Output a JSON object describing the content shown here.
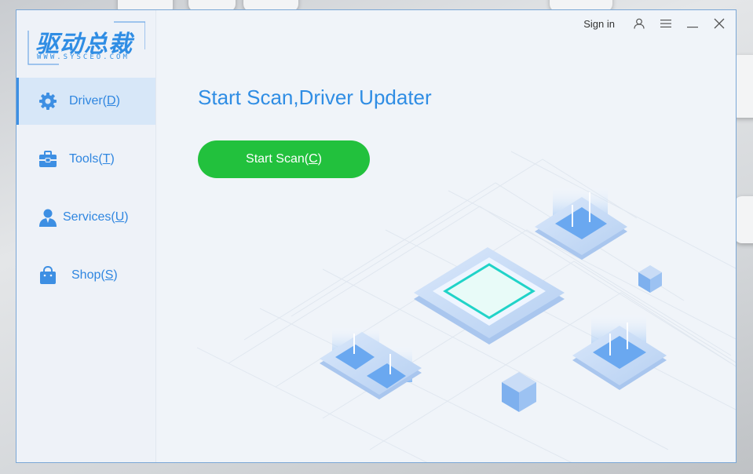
{
  "app": {
    "logo_text": "驱动总裁",
    "logo_sub": "WWW.SYSCEO.COM"
  },
  "topbar": {
    "signin_label": "Sign in",
    "user_icon": "user-icon",
    "menu_icon": "hamburger-menu-icon",
    "minimize_icon": "minimize-icon",
    "close_icon": "close-icon"
  },
  "sidebar": {
    "items": [
      {
        "label": "Driver",
        "hotkey": "D",
        "icon": "gear-icon",
        "active": true
      },
      {
        "label": "Tools",
        "hotkey": "T",
        "icon": "toolbox-icon",
        "active": false
      },
      {
        "label": "Services",
        "hotkey": "U",
        "icon": "person-icon",
        "active": false
      },
      {
        "label": "Shop",
        "hotkey": "S",
        "icon": "shopping-bag-icon",
        "active": false
      }
    ]
  },
  "main": {
    "headline": "Start Scan,Driver Updater",
    "scan_button": {
      "label": "Start Scan",
      "hotkey": "C"
    }
  },
  "colors": {
    "accent": "#2f8de4",
    "scan_green": "#22c13d",
    "active_bg": "#d7e7f8",
    "window_bg": "#f0f4f9"
  }
}
